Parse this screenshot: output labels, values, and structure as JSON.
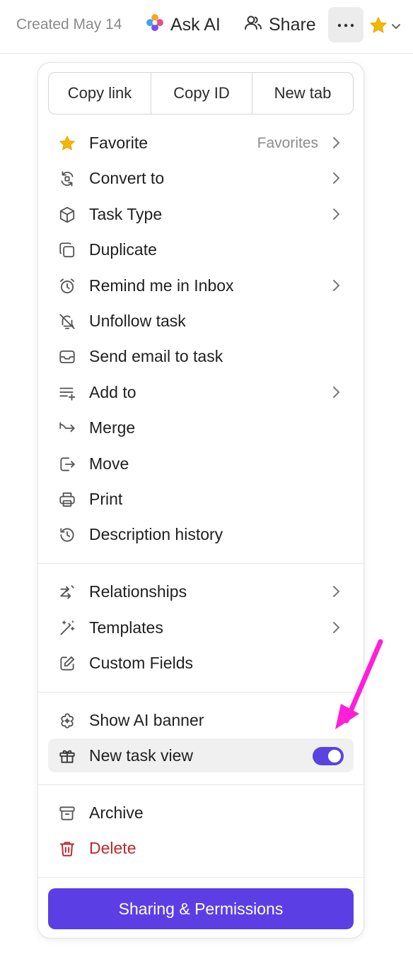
{
  "header": {
    "created": "Created May 14",
    "ask_ai": "Ask AI",
    "share": "Share"
  },
  "menu": {
    "quick_actions": [
      {
        "label": "Copy link"
      },
      {
        "label": "Copy ID"
      },
      {
        "label": "New tab"
      }
    ],
    "items": [
      {
        "label": "Favorite",
        "hint": "Favorites",
        "icon": "star-icon"
      },
      {
        "label": "Convert to",
        "icon": "convert-icon"
      },
      {
        "label": "Task Type",
        "icon": "cube-icon"
      },
      {
        "label": "Duplicate",
        "icon": "duplicate-icon"
      },
      {
        "label": "Remind me in Inbox",
        "icon": "alarm-icon"
      },
      {
        "label": "Unfollow task",
        "icon": "bell-off-icon"
      },
      {
        "label": "Send email to task",
        "icon": "mail-icon"
      },
      {
        "label": "Add to",
        "icon": "list-add-icon"
      },
      {
        "label": "Merge",
        "icon": "merge-icon"
      },
      {
        "label": "Move",
        "icon": "move-icon"
      },
      {
        "label": "Print",
        "icon": "printer-icon"
      },
      {
        "label": "Description history",
        "icon": "history-icon"
      }
    ],
    "items2": [
      {
        "label": "Relationships",
        "icon": "relationships-icon"
      },
      {
        "label": "Templates",
        "icon": "magic-wand-icon"
      },
      {
        "label": "Custom Fields",
        "icon": "edit-box-icon"
      }
    ],
    "items3": [
      {
        "label": "Show AI banner",
        "icon": "ai-flower-icon"
      },
      {
        "label": "New task view",
        "icon": "gift-icon",
        "toggle_on": true
      }
    ],
    "items4": [
      {
        "label": "Archive",
        "icon": "archive-icon"
      },
      {
        "label": "Delete",
        "icon": "trash-icon"
      }
    ],
    "primary_button": "Sharing & Permissions"
  },
  "colors": {
    "accent": "#5b3fe4",
    "danger": "#c0262d",
    "annotation_arrow": "#ff1fd8",
    "star": "#f5b800"
  }
}
